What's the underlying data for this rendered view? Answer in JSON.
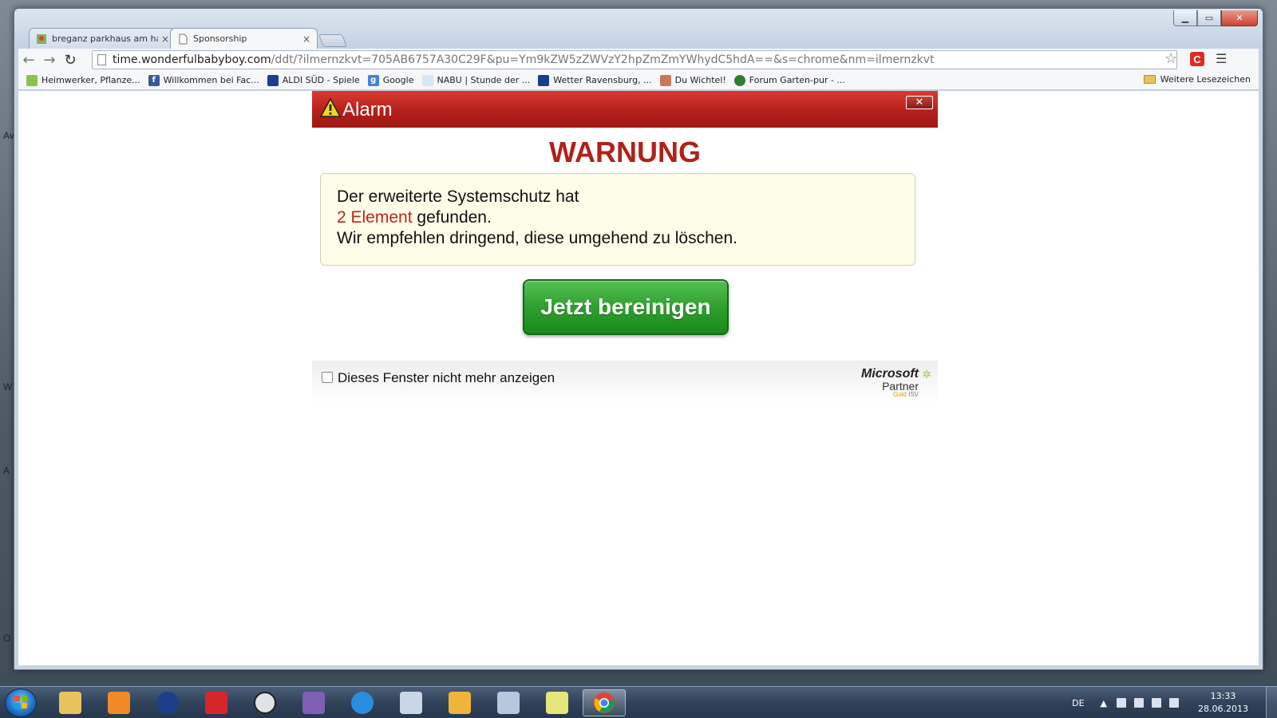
{
  "desktop": {
    "edge_letters": [
      "Av",
      "W",
      "A",
      "O"
    ]
  },
  "browser": {
    "tabs": [
      {
        "label": "breganz parkhaus am hafe",
        "close": "×",
        "active": false
      },
      {
        "label": "Sponsorship",
        "close": "×",
        "active": true
      }
    ],
    "url_host": "time.wonderfulbabyboy.com",
    "url_rest": "/ddt/?ilmernzkvt=705AB6757A30C29F&pu=Ym9kZW5zZWVzY2hpZmZmYWhydC5hdA==&s=chrome&nm=ilmernzkvt",
    "bookmarks": [
      {
        "label": "Heimwerker, Pflanze...",
        "icon": "plant-icon"
      },
      {
        "label": "Willkommen bei Fac...",
        "icon": "facebook-icon"
      },
      {
        "label": "ALDI SÜD - Spiele",
        "icon": "aldi-icon"
      },
      {
        "label": "Google",
        "icon": "google-icon"
      },
      {
        "label": "NABU | Stunde der ...",
        "icon": "nabu-icon"
      },
      {
        "label": "Wetter Ravensburg, ...",
        "icon": "weather-icon"
      },
      {
        "label": "Du Wichtel!",
        "icon": "gnome-icon"
      },
      {
        "label": "Forum Garten-pur - ...",
        "icon": "leaf-icon"
      }
    ],
    "other_bookmarks": "Weitere Lesezeichen"
  },
  "popup": {
    "title": "Alarm",
    "heading": "WARNUNG",
    "message_line1": "Der erweiterte Systemschutz hat",
    "message_count": "2 Element",
    "message_line2_rest": " gefunden.",
    "message_line3": "Wir empfehlen dringend, diese umgehend zu löschen.",
    "cta": "Jetzt bereinigen",
    "checkbox_label": "Dieses Fenster nicht mehr anzeigen",
    "partner": {
      "brand": "Microsoft",
      "label": "Partner",
      "gold": "Gold",
      "isv": "ISV"
    }
  },
  "taskbar": {
    "language": "DE",
    "time": "13:33",
    "date": "28.06.2013"
  },
  "colors": {
    "alarm_red": "#b5201a",
    "cta_green": "#2ea02e",
    "message_bg": "#fdfde8"
  }
}
